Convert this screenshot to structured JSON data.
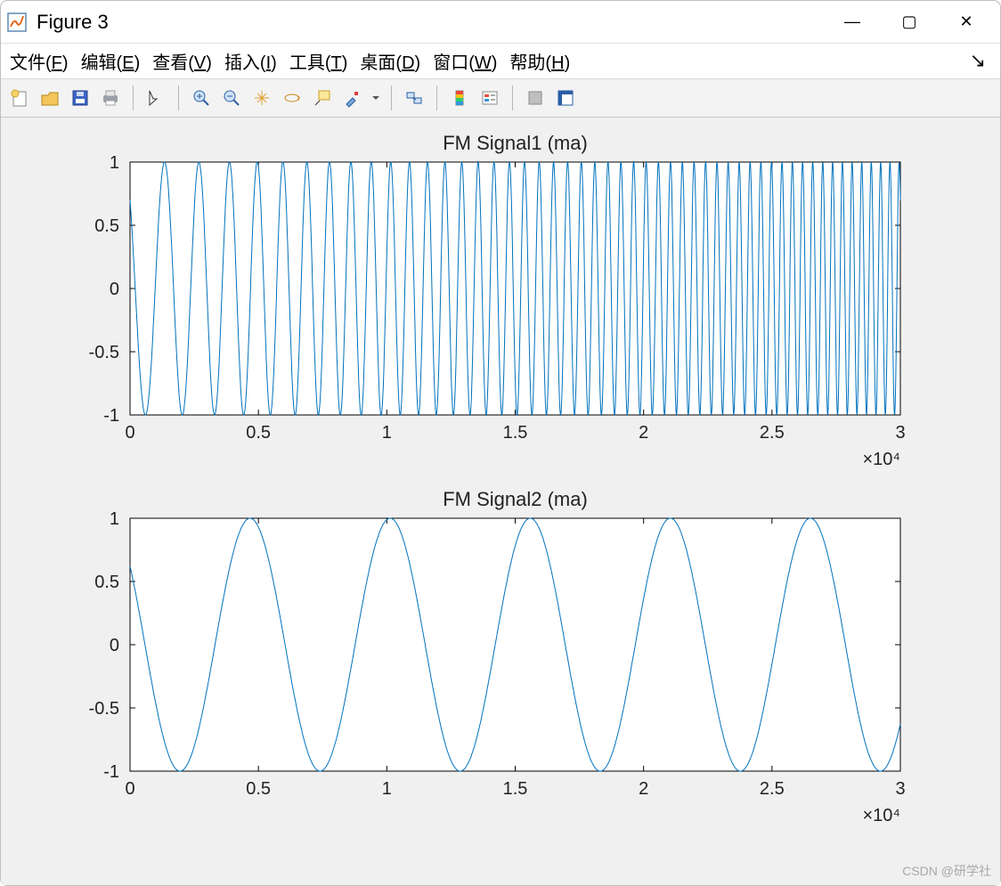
{
  "window": {
    "title": "Figure 3",
    "controls": {
      "minimize": "—",
      "maximize": "▢",
      "close": "✕"
    }
  },
  "menu": {
    "items": [
      {
        "label": "文件(F)",
        "underline": "F"
      },
      {
        "label": "编辑(E)",
        "underline": "E"
      },
      {
        "label": "查看(V)",
        "underline": "V"
      },
      {
        "label": "插入(I)",
        "underline": "I"
      },
      {
        "label": "工具(T)",
        "underline": "T"
      },
      {
        "label": "桌面(D)",
        "underline": "D"
      },
      {
        "label": "窗口(W)",
        "underline": "W"
      },
      {
        "label": "帮助(H)",
        "underline": "H"
      }
    ],
    "dock_arrow": "↘"
  },
  "toolbar": {
    "buttons": [
      "new-figure",
      "open",
      "save",
      "print",
      "|",
      "edit-plot",
      "|",
      "zoom-in",
      "zoom-out",
      "pan",
      "rotate",
      "data-cursor",
      "brush",
      "dropdown",
      "|",
      "link",
      "|",
      "colorbar",
      "legend",
      "|",
      "hide-plot",
      "show-plot"
    ]
  },
  "watermark": "CSDN @研学社",
  "chart_data": [
    {
      "type": "line",
      "title": "FM Signal1 (ma)",
      "xlabel": "",
      "ylabel": "",
      "xlim": [
        0,
        30000
      ],
      "ylim": [
        -1,
        1
      ],
      "x_exponent_label": "×10⁴",
      "x_ticks": [
        0,
        5000,
        10000,
        15000,
        20000,
        25000,
        30000
      ],
      "x_tick_labels": [
        "0",
        "0.5",
        "1",
        "1.5",
        "2",
        "2.5",
        "3"
      ],
      "y_ticks": [
        -1,
        -0.5,
        0,
        0.5,
        1
      ],
      "y_tick_labels": [
        "-1",
        "-0.5",
        "0",
        "0.5",
        "1"
      ],
      "signal": {
        "description": "chirp/FM — cos(phase) with phase''(t) linearly increasing; ~4 cycles in first quarter rising to ~14 cycles in last quarter across [0,30000]",
        "amplitude": 1,
        "phase0": 0.8,
        "f_start_cycles_per_sample": 0.0006,
        "f_end_cycles_per_sample": 0.0028,
        "samples": 30000
      }
    },
    {
      "type": "line",
      "title": "FM Signal2 (ma)",
      "xlabel": "",
      "ylabel": "",
      "xlim": [
        0,
        30000
      ],
      "ylim": [
        -1,
        1
      ],
      "x_exponent_label": "×10⁴",
      "x_ticks": [
        0,
        5000,
        10000,
        15000,
        20000,
        25000,
        30000
      ],
      "x_tick_labels": [
        "0",
        "0.5",
        "1",
        "1.5",
        "2",
        "2.5",
        "3"
      ],
      "y_ticks": [
        -1,
        -0.5,
        0,
        0.5,
        1
      ],
      "y_tick_labels": [
        "-1",
        "-0.5",
        "0",
        "0.5",
        "1"
      ],
      "signal": {
        "description": "near-pure tone, ~5.5 cycles over [0,30000], starts ≈0.78 at t=0",
        "amplitude": 1,
        "phase0": 0.9,
        "freq_cycles_per_sample": 0.0001833,
        "samples": 30000
      }
    }
  ]
}
